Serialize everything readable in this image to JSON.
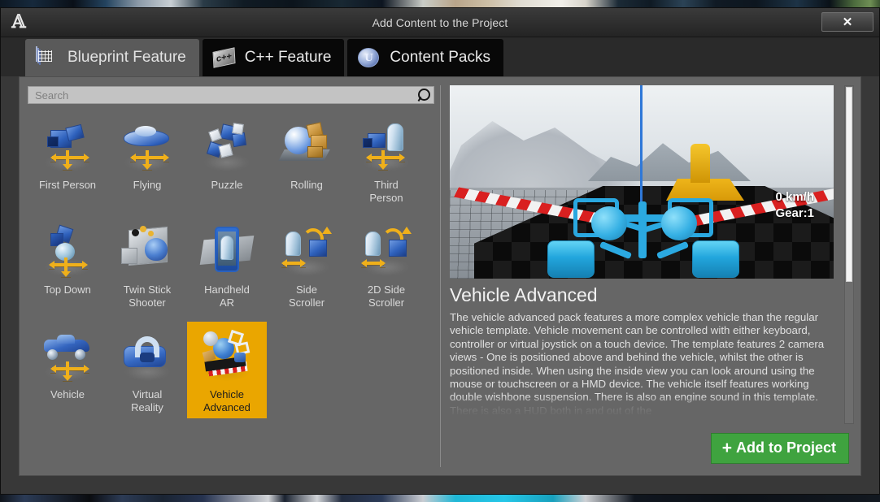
{
  "window": {
    "title": "Add Content to the Project",
    "logo_icon": "unreal-engine-logo",
    "close_label": "✕"
  },
  "tabs": [
    {
      "label": "Blueprint Feature",
      "icon": "blueprint-icon",
      "icon_text": "",
      "active": true
    },
    {
      "label": "C++ Feature",
      "icon": "cpp-card-icon",
      "icon_text": "c++",
      "active": false
    },
    {
      "label": "Content Packs",
      "icon": "content-pack-sphere-icon",
      "icon_text": "U",
      "active": false
    }
  ],
  "search": {
    "placeholder": "Search",
    "value": "",
    "icon": "search-icon"
  },
  "templates": [
    {
      "label": "First Person",
      "selected": false
    },
    {
      "label": "Flying",
      "selected": false
    },
    {
      "label": "Puzzle",
      "selected": false
    },
    {
      "label": "Rolling",
      "selected": false
    },
    {
      "label": "Third\nPerson",
      "selected": false
    },
    {
      "label": "Top Down",
      "selected": false
    },
    {
      "label": "Twin Stick\nShooter",
      "selected": false
    },
    {
      "label": "Handheld\nAR",
      "selected": false
    },
    {
      "label": "Side\nScroller",
      "selected": false
    },
    {
      "label": "2D Side\nScroller",
      "selected": false
    },
    {
      "label": "Vehicle",
      "selected": false
    },
    {
      "label": "Virtual\nReality",
      "selected": false
    },
    {
      "label": "Vehicle\nAdvanced",
      "selected": true
    }
  ],
  "detail": {
    "title": "Vehicle Advanced",
    "description": "The vehicle advanced pack features a more complex vehicle than the regular vehicle template. Vehicle movement can be controlled with either keyboard, controller or virtual joystick on a touch device. The template features 2 camera views - One is positioned above and behind the vehicle, whilst the other is positioned inside. When using the inside view you can look around using the mouse or touchscreen or a HMD device. The vehicle itself features working double wishbone suspension. There is also an engine sound in this template. There is also a HUD both in and out of the",
    "preview": {
      "hud_speed": "0 km/h",
      "hud_gear": "Gear:1"
    }
  },
  "actions": {
    "add_to_project": "Add to Project",
    "add_to_project_plus": "+"
  },
  "colors": {
    "selected_tile": "#eaa600",
    "add_button": "#3fa33f",
    "panel_bg": "#666666",
    "dialog_bg": "#383838"
  }
}
